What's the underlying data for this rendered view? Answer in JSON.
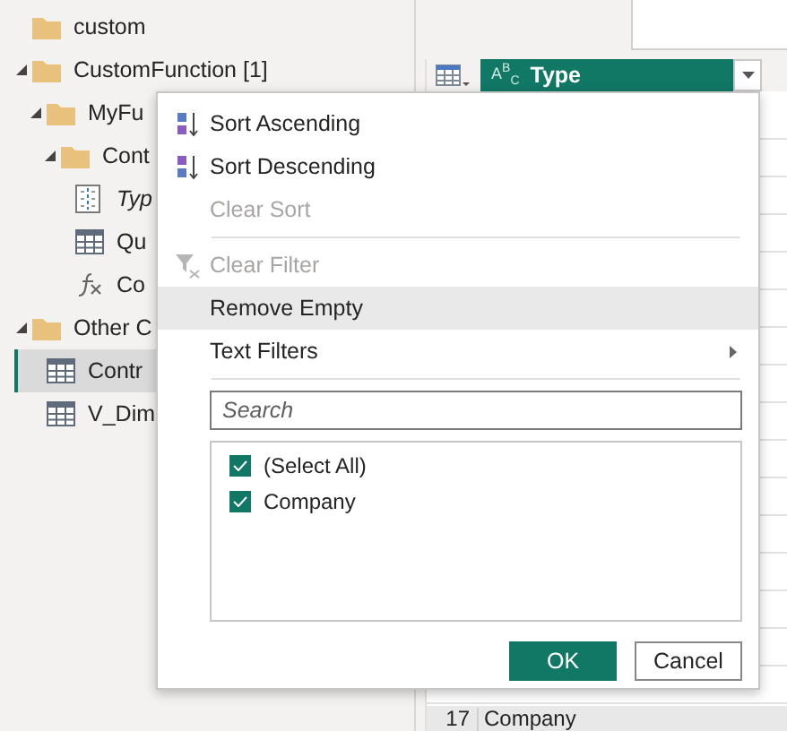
{
  "sidebar": {
    "items": [
      {
        "label": "custom",
        "kind": "folder",
        "selected": false
      },
      {
        "label": "CustomFunction [1]",
        "kind": "folder",
        "expanded": true,
        "selected": false,
        "children": [
          {
            "label": "MyFu",
            "kind": "folder",
            "expanded": true,
            "selected": false,
            "children": [
              {
                "label": "Cont",
                "kind": "folder",
                "expanded": true,
                "selected": false,
                "children": [
                  {
                    "label": "Typ",
                    "kind": "parameter",
                    "selected": false
                  },
                  {
                    "label": "Qu",
                    "kind": "table",
                    "selected": false
                  },
                  {
                    "label": "Co",
                    "kind": "function",
                    "selected": false
                  }
                ]
              }
            ]
          }
        ]
      },
      {
        "label": "Other C",
        "kind": "folder",
        "expanded": true,
        "selected": false,
        "children": [
          {
            "label": "Contr",
            "kind": "table",
            "selected": true
          },
          {
            "label": "V_Dim",
            "kind": "table",
            "selected": false
          }
        ]
      }
    ]
  },
  "grid": {
    "column": {
      "type_label": "A$^{B}$$_{C}$",
      "label": "Type"
    },
    "rows": [
      {
        "number": "17",
        "value": "Company"
      }
    ]
  },
  "filter_menu": {
    "items": [
      {
        "kind": "ascending",
        "label": "Sort Ascending",
        "disabled": false,
        "hovered": false
      },
      {
        "kind": "descending",
        "label": "Sort Descending",
        "disabled": false,
        "hovered": false
      },
      {
        "kind": "plain",
        "label": "Clear Sort",
        "disabled": true,
        "hovered": false
      },
      {
        "kind": "separator"
      },
      {
        "kind": "unfilter",
        "label": "Clear Filter",
        "disabled": true,
        "hovered": false
      },
      {
        "kind": "plain",
        "label": "Remove Empty",
        "disabled": false,
        "hovered": true
      },
      {
        "kind": "submenu",
        "label": "Text Filters",
        "disabled": false,
        "hovered": false
      },
      {
        "kind": "separator"
      }
    ],
    "search": {
      "placeholder": "Search"
    },
    "values": [
      {
        "label": "(Select All)",
        "checked": true
      },
      {
        "label": "Company",
        "checked": true
      }
    ],
    "buttons": [
      {
        "label": "OK",
        "kind": "primary"
      },
      {
        "label": "Cancel",
        "kind": "secondary"
      }
    ]
  }
}
